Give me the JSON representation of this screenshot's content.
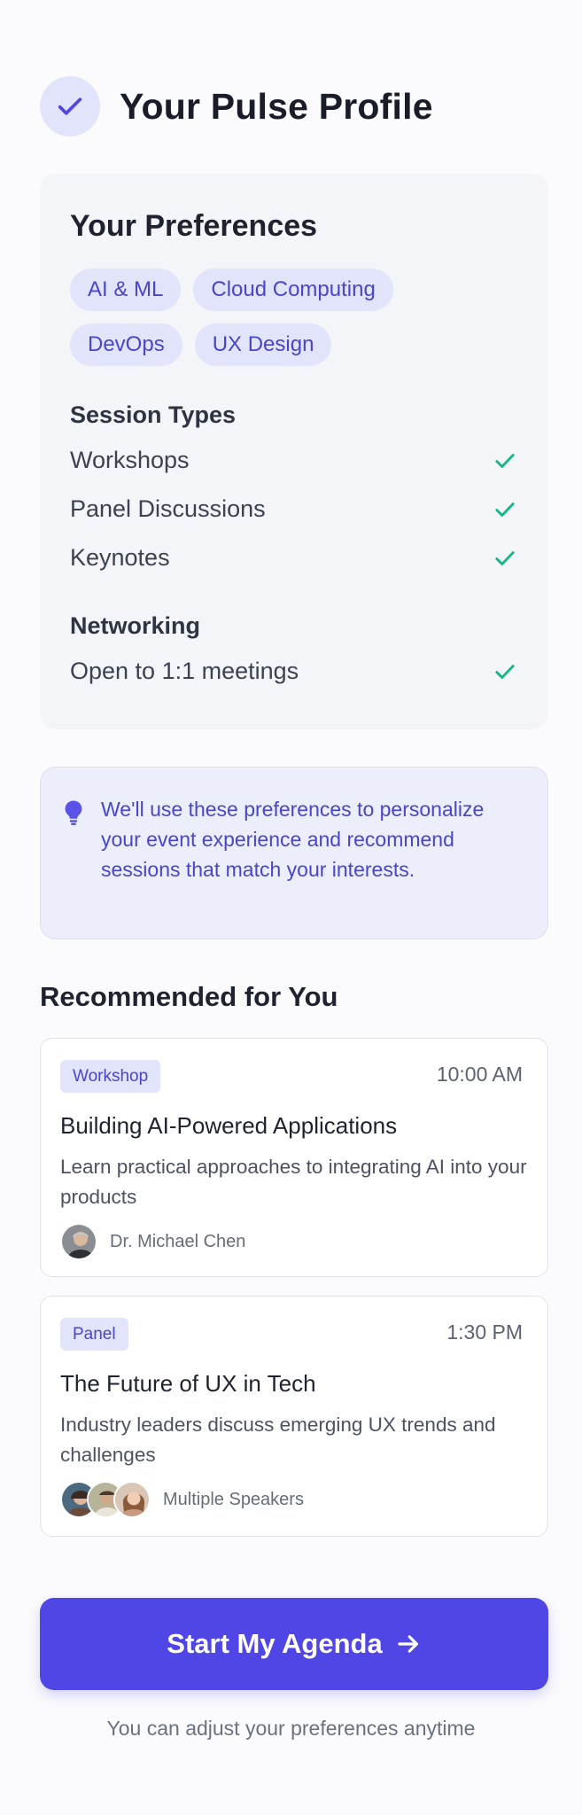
{
  "header": {
    "title": "Your Pulse Profile",
    "badge_icon": "checkmark-icon"
  },
  "preferences": {
    "title": "Your Preferences",
    "tags": [
      "AI & ML",
      "Cloud Computing",
      "DevOps",
      "UX Design"
    ],
    "session_types": {
      "label": "Session Types",
      "items": [
        {
          "label": "Workshops",
          "checked": true
        },
        {
          "label": "Panel Discussions",
          "checked": true
        },
        {
          "label": "Keynotes",
          "checked": true
        }
      ]
    },
    "networking": {
      "label": "Networking",
      "items": [
        {
          "label": "Open to 1:1 meetings",
          "checked": true
        }
      ]
    }
  },
  "info": {
    "icon": "lightbulb-icon",
    "text": "We'll use these preferences to personalize your event experience and recommend sessions that match your interests."
  },
  "recommended": {
    "title": "Recommended for You",
    "events": [
      {
        "type": "Workshop",
        "time": "10:00 AM",
        "title": "Building AI-Powered Applications",
        "description": "Learn practical approaches to integrating AI into your products",
        "speaker": "Dr. Michael Chen"
      },
      {
        "type": "Panel",
        "time": "1:30 PM",
        "title": "The Future of UX in Tech",
        "description": "Industry leaders discuss emerging UX trends and challenges",
        "speaker": "Multiple Speakers"
      }
    ]
  },
  "cta": {
    "label": "Start My Agenda",
    "icon": "arrow-right-icon"
  },
  "footnote": "You can adjust your preferences anytime",
  "colors": {
    "accent": "#4f46e5",
    "check_green": "#10b981",
    "badge_bg": "#e2e4fb",
    "accent_text": "#4a45c9"
  }
}
